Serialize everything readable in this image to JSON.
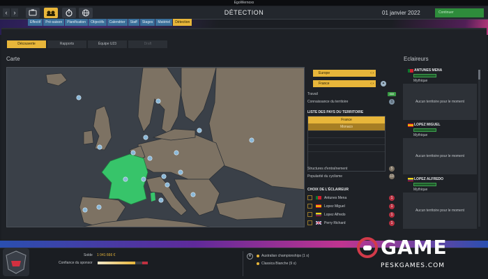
{
  "window": {
    "title": "EgoWernoxx"
  },
  "header": {
    "page_title": "DÉTECTION",
    "date": "01 janvier 2022",
    "continue_label": "Continuer",
    "nav_back": "‹",
    "nav_forward": "›",
    "icons": [
      "team-icon",
      "handshake-icon",
      "stopwatch-icon",
      "globe-icon"
    ]
  },
  "tabs": [
    {
      "label": "Effectif",
      "active": false
    },
    {
      "label": "Pré-saison",
      "active": false
    },
    {
      "label": "Planification",
      "active": false
    },
    {
      "label": "Objectifs",
      "active": false
    },
    {
      "label": "Calendrier",
      "active": false
    },
    {
      "label": "Staff",
      "active": false
    },
    {
      "label": "Stages",
      "active": false
    },
    {
      "label": "Matériel",
      "active": false
    },
    {
      "label": "Détection",
      "active": true
    }
  ],
  "subtabs": [
    {
      "label": "Découverte",
      "state": "active"
    },
    {
      "label": "Rapports",
      "state": "normal"
    },
    {
      "label": "Équipe U23",
      "state": "normal"
    },
    {
      "label": "Draft",
      "state": "disabled"
    }
  ],
  "map_section": {
    "title": "Carte"
  },
  "filters": {
    "region": "Europe",
    "country": "France",
    "rows": [
      {
        "label": "Travail",
        "value": "888"
      },
      {
        "label": "Connaissance du territoire",
        "value": "1"
      }
    ],
    "countries_title": "LISTE DES PAYS DU TERRITOIRE",
    "countries": [
      "France",
      "Monaco"
    ],
    "structures_label": "Structures d'entraînement",
    "structures_value": "5",
    "popularity_label": "Popularité du cyclisme",
    "popularity_value": "10"
  },
  "scout_choice": {
    "title": "CHOIX DE L'ÉCLAIREUR",
    "items": [
      {
        "name": "Antunes Mena",
        "flag": "portugal",
        "value": "1"
      },
      {
        "name": "Lopez Miguel",
        "flag": "spain",
        "value": "1"
      },
      {
        "name": "Lopez Alfredo",
        "flag": "colombia",
        "value": "1"
      },
      {
        "name": "Perry Richard",
        "flag": "uk",
        "value": "1"
      }
    ]
  },
  "scouts": {
    "title": "Eclaireurs",
    "cards": [
      {
        "name": "ANTUNES MENA",
        "flag": "portugal",
        "role": "Mythique",
        "status": "Aucun territoire pour le moment"
      },
      {
        "name": "LOPEZ MIGUEL",
        "flag": "spain",
        "role": "Mythique",
        "status": "Aucun territoire pour le moment"
      },
      {
        "name": "LOPEZ ALFREDO",
        "flag": "colombia",
        "role": "Mythique",
        "status": "Aucun territoire pour le moment"
      }
    ]
  },
  "footer": {
    "balance_label": "Solde",
    "balance_value": "1 041 666 €",
    "sponsor_label": "Confiance du sponsor",
    "sponsor_level": 0.75,
    "competitions": [
      {
        "name": "Australian championships",
        "count": "(1 s)"
      },
      {
        "name": "Classica Bianche",
        "count": "(9 s)"
      }
    ]
  },
  "watermark": {
    "main": "GAME",
    "sub": "PESKGAMES.COM"
  },
  "colors": {
    "accent": "#e8b63a",
    "map_land": "#7d7263",
    "map_selected": "#37c46a",
    "map_sea": "#3a4048",
    "badge_red": "#b83040",
    "badge_green": "#3a9b45"
  }
}
